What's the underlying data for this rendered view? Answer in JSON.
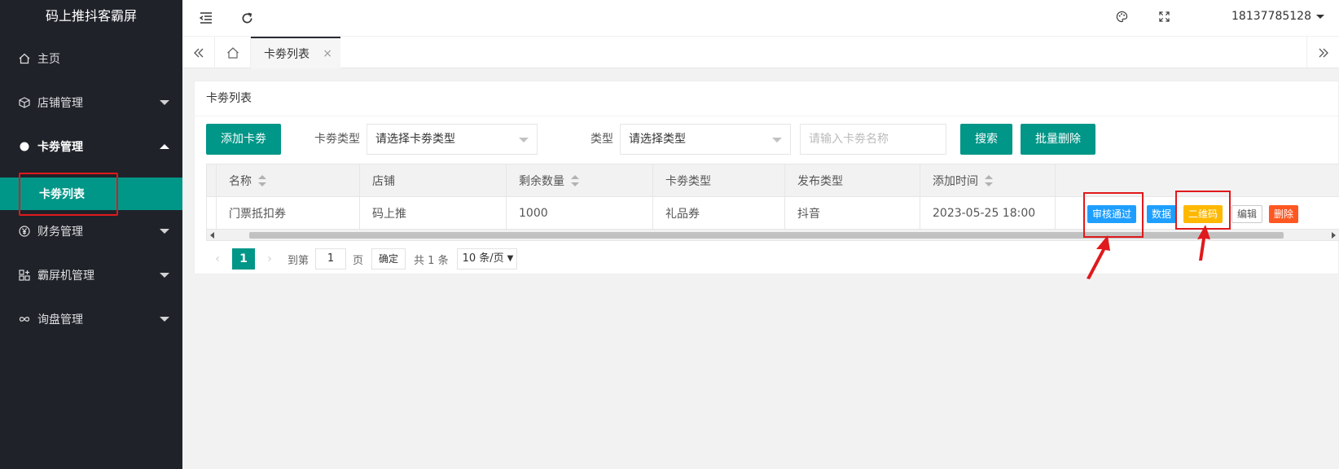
{
  "app": {
    "title": "码上推抖客霸屏"
  },
  "sidebar": {
    "items": [
      {
        "label": "主页",
        "icon": "home-icon"
      },
      {
        "label": "店铺管理",
        "icon": "cube-icon"
      },
      {
        "label": "卡劵管理",
        "icon": "circle-icon"
      },
      {
        "label": "财务管理",
        "icon": "yen-icon"
      },
      {
        "label": "霸屏机管理",
        "icon": "apps-icon"
      },
      {
        "label": "询盘管理",
        "icon": "infinity-icon"
      }
    ],
    "sub_active": "卡劵列表"
  },
  "header": {
    "user": "18137785128"
  },
  "tabs": {
    "current": "卡劵列表"
  },
  "card": {
    "title": "卡劵列表"
  },
  "toolbar": {
    "add_button": "添加卡劵",
    "type_label": "卡劵类型",
    "type_select": "请选择卡劵类型",
    "category_label": "类型",
    "category_select": "请选择类型",
    "name_placeholder": "请输入卡劵名称",
    "search_button": "搜索",
    "batch_delete_button": "批量删除"
  },
  "table": {
    "headers": [
      "名称",
      "店铺",
      "剩余数量",
      "卡劵类型",
      "发布类型",
      "添加时间",
      ""
    ],
    "rows": [
      {
        "name": "门票抵扣券",
        "shop": "码上推",
        "remaining": "1000",
        "coupon_type": "礼品券",
        "publish_type": "抖音",
        "added": "2023-05-25 18:00"
      }
    ],
    "actions": {
      "approve": "审核通过",
      "data": "数据",
      "qrcode": "二维码",
      "edit": "编辑",
      "delete": "删除"
    }
  },
  "pager": {
    "current": "1",
    "goto_label": "到第",
    "goto_value": "1",
    "page_unit": "页",
    "confirm": "确定",
    "total": "共 1 条",
    "limit": "10 条/页"
  },
  "colors": {
    "primary": "#009688",
    "sidebar": "#20222a",
    "blue": "#1e9fff",
    "yellow": "#ffb800",
    "red": "#ff5722",
    "annotation": "#e0191c"
  }
}
